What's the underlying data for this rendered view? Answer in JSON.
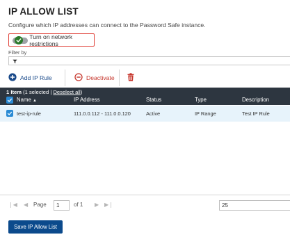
{
  "header": {
    "title": "IP ALLOW LIST",
    "subtitle": "Configure which IP addresses can connect to the Password Safe instance."
  },
  "toggle": {
    "label": "Turn on network restrictions",
    "state": "on",
    "accent": "#2b7a2b",
    "highlight": "#e0433a"
  },
  "filter": {
    "label": "Filter by",
    "icon": "funnel-icon"
  },
  "toolbar": {
    "add_label": "Add IP Rule",
    "deactivate_label": "Deactivate",
    "delete_icon": "trash-icon"
  },
  "grid": {
    "count": "1 Item",
    "selected": "(1 selected |",
    "deselect_label": "Deselect all",
    "deselect_suffix": ")",
    "columns": {
      "name": "Name",
      "ip": "IP Address",
      "status": "Status",
      "type": "Type",
      "description": "Description"
    },
    "rows": [
      {
        "name": "test-ip-rule",
        "ip": "111.0.0.112 - 111.0.0.120",
        "status": "Active",
        "type": "IP Range",
        "description": "Test IP Rule",
        "checked": true
      }
    ],
    "header_bg": "#2d3640"
  },
  "pager": {
    "page_label": "Page",
    "page_value": "1",
    "of_label": "of 1",
    "page_size": "25"
  },
  "footer": {
    "save_label": "Save IP Allow List"
  }
}
